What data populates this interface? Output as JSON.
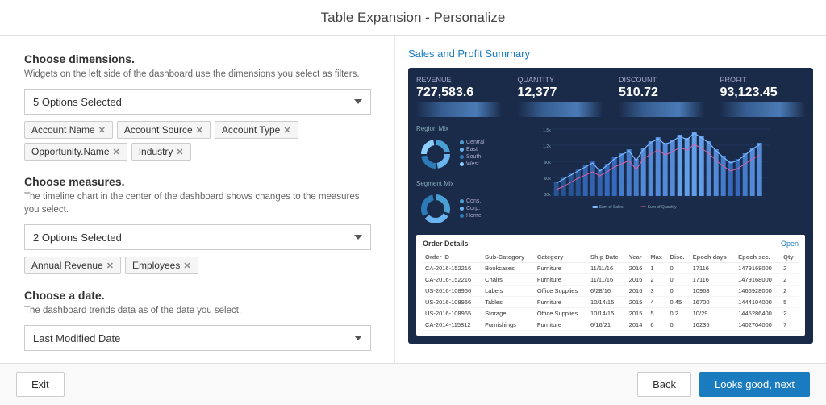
{
  "header": {
    "title": "Table Expansion - Personalize"
  },
  "left": {
    "dimensions": {
      "section_title": "Choose dimensions.",
      "section_desc": "Widgets on the left side of the dashboard use the dimensions you select as filters.",
      "dropdown_value": "5 Options Selected",
      "tags": [
        "Account Name",
        "Account Source",
        "Account Type",
        "Opportunity.Name",
        "Industry"
      ]
    },
    "measures": {
      "section_title": "Choose measures.",
      "section_desc": "The timeline chart in the center of the dashboard shows changes to the measures you select.",
      "dropdown_value": "2 Options Selected",
      "tags": [
        "Annual Revenue",
        "Employees"
      ]
    },
    "date": {
      "section_title": "Choose a date.",
      "section_desc": "The dashboard trends data as of the date you select.",
      "dropdown_value": "Last Modified Date"
    }
  },
  "right": {
    "chart_title": "Sales and Profit Summary",
    "metrics": [
      {
        "label": "Revenue",
        "value": "727,583.6"
      },
      {
        "label": "Quantity",
        "value": "12,377"
      },
      {
        "label": "Discount",
        "value": "510.72"
      },
      {
        "label": "Profit",
        "value": "93,123.45"
      }
    ],
    "donuts": [
      {
        "title": "Region Mix",
        "legend": [
          "Central",
          "East",
          "South",
          "West"
        ],
        "colors": [
          "#4a9fd4",
          "#6ab4f0",
          "#2d7ab8",
          "#8ccfff"
        ]
      },
      {
        "title": "Segment Mix",
        "legend": [
          "Cons.",
          "Corp.",
          "Home"
        ],
        "colors": [
          "#4a9fd4",
          "#6ab4f0",
          "#2d7ab8"
        ]
      }
    ],
    "order_details": {
      "title": "Order Details",
      "open_label": "Open",
      "columns": [
        "Order ID",
        "Sub-Category",
        "Category",
        "Ship Date",
        "Ship Date (Year)",
        "Max ID",
        "Discount",
        "Ship Date (Epoch days)",
        "Ship Date (Epoch seconds)",
        "Quantity"
      ],
      "rows": [
        [
          "CA-2016-152216",
          "Bookcases",
          "Furniture",
          "11/11/16",
          "2016",
          "1",
          "0",
          "17116",
          "1479168000",
          "2"
        ],
        [
          "CA-2016-152216",
          "Chairs",
          "Furniture",
          "11/11/16",
          "2016",
          "2",
          "0",
          "17116",
          "1479168000",
          "2"
        ],
        [
          "US-2016-108966",
          "Labels",
          "Office Supplies",
          "6/28/16",
          "2016",
          "3",
          "0",
          "10968",
          "1466928000",
          "2"
        ],
        [
          "US-2016-108966",
          "Tables",
          "Furniture",
          "10/14/15",
          "2015",
          "4",
          "0.45",
          "16700",
          "1444104000",
          "5"
        ],
        [
          "US-2016-108965",
          "Storage",
          "Office Supplies",
          "10/14/15",
          "2015",
          "5",
          "0.2",
          "10/29",
          "1445286400",
          "2"
        ],
        [
          "CA-2014-115812",
          "Furnishings",
          "Furniture",
          "6/16/21",
          "2014",
          "6",
          "0",
          "16235",
          "1402704000",
          "7"
        ]
      ]
    }
  },
  "footer": {
    "exit_label": "Exit",
    "back_label": "Back",
    "next_label": "Looks good, next"
  }
}
